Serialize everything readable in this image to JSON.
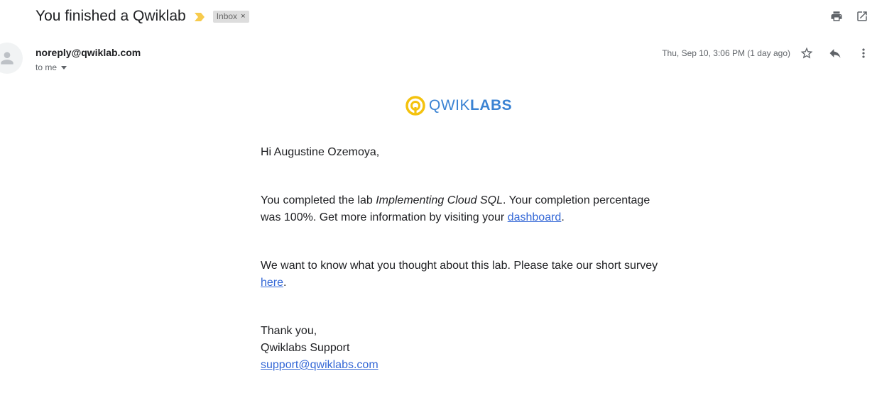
{
  "subject": "You finished a Qwiklab",
  "label_chip": {
    "text": "Inbox",
    "close": "×"
  },
  "colors": {
    "importance": "#f7cb4d",
    "link": "#3367d6",
    "logo_blue": "#3b83d3",
    "logo_yellow": "#f4c20d"
  },
  "sender": {
    "email": "noreply@qwiklab.com",
    "to": "to me",
    "date": "Thu, Sep 10, 3:06 PM (1 day ago)"
  },
  "icons": {
    "print": "print-icon",
    "open_new": "open-in-new-window-icon",
    "star": "star-icon",
    "reply": "reply-icon",
    "more": "more-vert-icon",
    "avatar": "person-icon",
    "caret": "chevron-down-icon"
  },
  "logo": {
    "light": "QWIK",
    "bold": "LABS"
  },
  "message": {
    "greeting": "Hi Augustine Ozemoya,",
    "p1_before": "You completed the lab ",
    "p1_lab": "Implementing Cloud SQL",
    "p1_middle": ". Your completion percentage was 100%. Get more information by visiting your ",
    "p1_link": "dashboard",
    "p1_after": ".",
    "p2_before": "We want to know what you thought about this lab. Please take our short survey ",
    "p2_link": "here",
    "p2_after": ".",
    "closing_1": "Thank you,",
    "closing_2": "Qwiklabs Support",
    "support_email": "support@qwiklabs.com"
  }
}
